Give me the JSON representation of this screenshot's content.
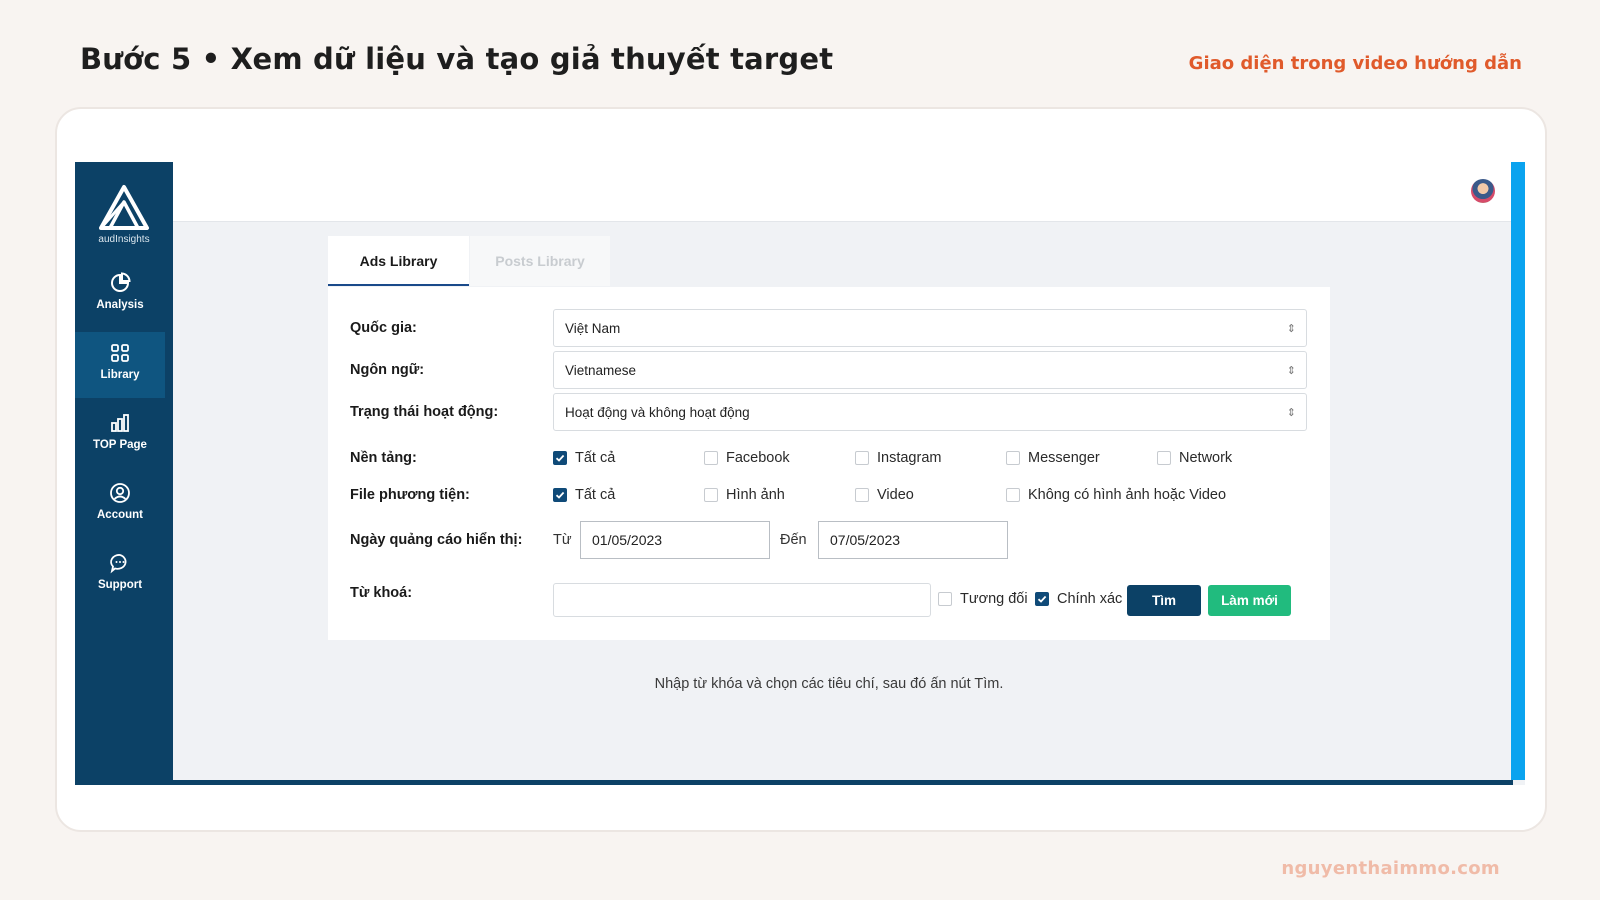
{
  "slide": {
    "title": "Bước 5 • Xem dữ liệu và tạo giả thuyết target",
    "tag": "Giao diện trong video hướng dẫn",
    "footer": "nguyenthaimmo.com"
  },
  "sidebar": {
    "logo_text": "audInsights",
    "items": [
      {
        "label": "Analysis",
        "icon": "pie-chart-icon",
        "active": false
      },
      {
        "label": "Library",
        "icon": "grid-icon",
        "active": true
      },
      {
        "label": "TOP Page",
        "icon": "bar-chart-icon",
        "active": false
      },
      {
        "label": "Account",
        "icon": "user-circle-icon",
        "active": false
      },
      {
        "label": "Support",
        "icon": "chat-bubble-icon",
        "active": false
      }
    ]
  },
  "tabs": [
    {
      "label": "Ads Library",
      "active": true
    },
    {
      "label": "Posts Library",
      "active": false
    }
  ],
  "form": {
    "country": {
      "label": "Quốc gia:",
      "value": "Việt Nam"
    },
    "language": {
      "label": "Ngôn ngữ:",
      "value": "Vietnamese"
    },
    "status": {
      "label": "Trạng thái hoạt động:",
      "value": "Hoạt động và không hoạt động"
    },
    "platform": {
      "label": "Nền tảng:",
      "options": [
        {
          "label": "Tất cả",
          "checked": true
        },
        {
          "label": "Facebook",
          "checked": false
        },
        {
          "label": "Instagram",
          "checked": false
        },
        {
          "label": "Messenger",
          "checked": false
        },
        {
          "label": "Network",
          "checked": false
        }
      ]
    },
    "media": {
      "label": "File phương tiện:",
      "options": [
        {
          "label": "Tất cả",
          "checked": true
        },
        {
          "label": "Hình ảnh",
          "checked": false
        },
        {
          "label": "Video",
          "checked": false
        },
        {
          "label": "Không có hình ảnh hoặc Video",
          "checked": false
        }
      ]
    },
    "date": {
      "label": "Ngày quảng cáo hiển thị:",
      "from_label": "Từ",
      "from_value": "01/05/2023",
      "to_label": "Đến",
      "to_value": "07/05/2023"
    },
    "keyword": {
      "label": "Từ khoá:",
      "value": "",
      "relative_label": "Tương đối",
      "relative_checked": false,
      "exact_label": "Chính xác",
      "exact_checked": true
    },
    "search_button": "Tìm",
    "reset_button": "Làm mới"
  },
  "hint": "Nhập từ khóa và chọn các tiêu chí, sau đó ấn nút Tìm.",
  "colors": {
    "sidebar": "#0c4166",
    "accent_blue": "#0aa3ef",
    "reset_green": "#21bb7e",
    "tag_orange": "#e05a2b"
  }
}
